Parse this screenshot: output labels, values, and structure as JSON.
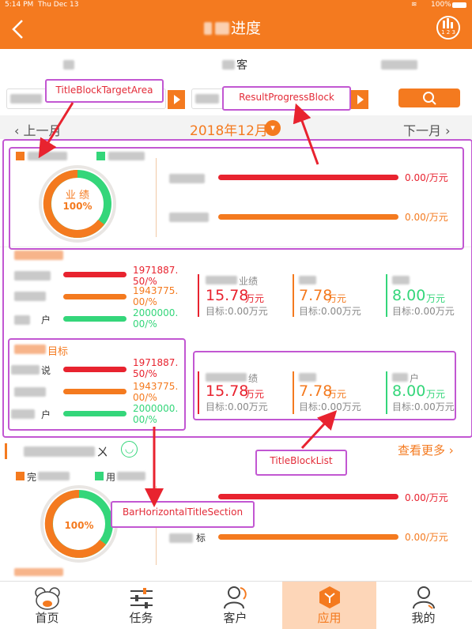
{
  "status_bar": {
    "time": "5:14 PM",
    "date": "Thu Dec 13",
    "battery": "100%"
  },
  "nav": {
    "title": "进度",
    "back_icon": "chevron-left-icon",
    "right_icon": "ranking-icon",
    "right_badge": "1 2 3"
  },
  "tabs": [
    "",
    "客",
    ""
  ],
  "month_nav": {
    "prev": "上一月",
    "current": "2018年12月",
    "next": "下一月"
  },
  "annotations": {
    "title_block_target_area": "TitleBlockTargetArea",
    "result_progress_block": "ResultProgressBlock",
    "title_block_list": "TitleBlockList",
    "bar_horizontal_title_section": "BarHorizontalTitleSection"
  },
  "section1": {
    "donut": {
      "label": "业 绩",
      "percent": "100%",
      "progress": 1.0
    },
    "rows": [
      {
        "value": "0.00/万元",
        "color": "#e8232f",
        "fill": 1.0
      },
      {
        "value": "0.00/万元",
        "color": "#f47a1f",
        "fill": 1.0
      }
    ]
  },
  "section2": {
    "bars": [
      {
        "value": "1971887.50/%",
        "color": "#e8232f"
      },
      {
        "value": "1943775.00/%",
        "color": "#f47a1f"
      },
      {
        "value": "2000000.00/%",
        "color": "#34d67a"
      }
    ],
    "row_labels": [
      "户"
    ],
    "stats": [
      {
        "label": "业绩",
        "value": "15.78",
        "unit": "万元",
        "target": "目标:0.00万元",
        "color": "#e8232f"
      },
      {
        "label": "",
        "value": "7.78",
        "unit": "万元",
        "target": "目标:0.00万元",
        "color": "#f47a1f"
      },
      {
        "label": "",
        "value": "8.00",
        "unit": "万元",
        "target": "目标:0.00万元",
        "color": "#34d67a"
      }
    ]
  },
  "section3": {
    "title": "目标",
    "bars": [
      {
        "value": "1971887.50/%",
        "color": "#e8232f"
      },
      {
        "value": "1943775.00/%",
        "color": "#f47a1f"
      },
      {
        "value": "2000000.00/%",
        "color": "#34d67a"
      }
    ],
    "row_labels": [
      "说",
      "户"
    ],
    "stats": [
      {
        "label": "绩",
        "value": "15.78",
        "unit": "万元",
        "target": "目标:0.00万元",
        "color": "#e8232f"
      },
      {
        "label": "",
        "value": "7.78",
        "unit": "万元",
        "target": "目标:0.00万元",
        "color": "#f47a1f"
      },
      {
        "label": "户",
        "value": "8.00",
        "unit": "万元",
        "target": "目标:0.00万元",
        "color": "#34d67a"
      }
    ]
  },
  "section4": {
    "header_suffix": "ㄨ",
    "more": "查看更多",
    "legend": [
      {
        "text": "完",
        "color": "#f47a1f"
      },
      {
        "text": "用",
        "color": "#34d67a"
      }
    ],
    "donut": {
      "percent": "100%",
      "progress": 1.0
    },
    "rows": [
      {
        "value": "0.00/万元",
        "color": "#e8232f"
      },
      {
        "value": "0.00/万元",
        "color": "#f47a1f"
      }
    ],
    "row2_label": "标"
  },
  "bottom_tabs": [
    {
      "label": "首页",
      "icon": "bear-icon"
    },
    {
      "label": "任务",
      "icon": "sliders-icon"
    },
    {
      "label": "客户",
      "icon": "customer-icon"
    },
    {
      "label": "应用",
      "icon": "app-cube-icon"
    },
    {
      "label": "我的",
      "icon": "person-icon"
    }
  ]
}
